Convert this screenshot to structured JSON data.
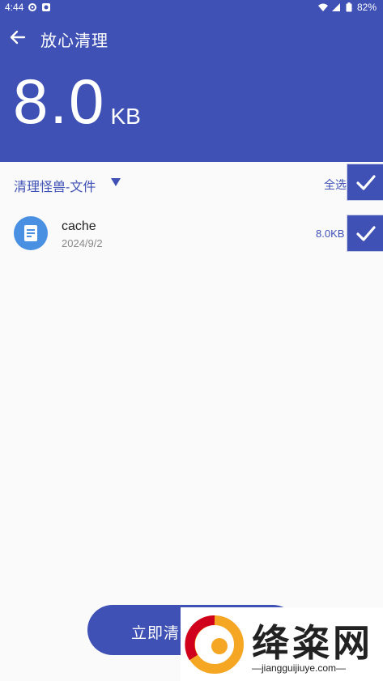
{
  "status_bar": {
    "time": "4:44",
    "battery": "82%"
  },
  "app_bar": {
    "title": "放心清理"
  },
  "summary": {
    "size_value": "8.0",
    "size_unit": "KB"
  },
  "filter": {
    "label": "清理怪兽-文件",
    "select_all_label": "全选",
    "select_all_checked": true
  },
  "items": [
    {
      "name": "cache",
      "date": "2024/9/2",
      "size": "8.0KB",
      "checked": true
    }
  ],
  "actions": {
    "clean_label": "立即清"
  },
  "watermark": {
    "text": "绛粢网",
    "domain": "—jiangguijiuye.com—"
  },
  "colors": {
    "primary": "#3f51b5",
    "file_icon": "#4a90e2",
    "background": "#fafafa"
  },
  "icons": {
    "back": "arrow-left-icon",
    "filter_caret": "caret-down-icon",
    "check": "check-icon",
    "file": "document-icon"
  }
}
